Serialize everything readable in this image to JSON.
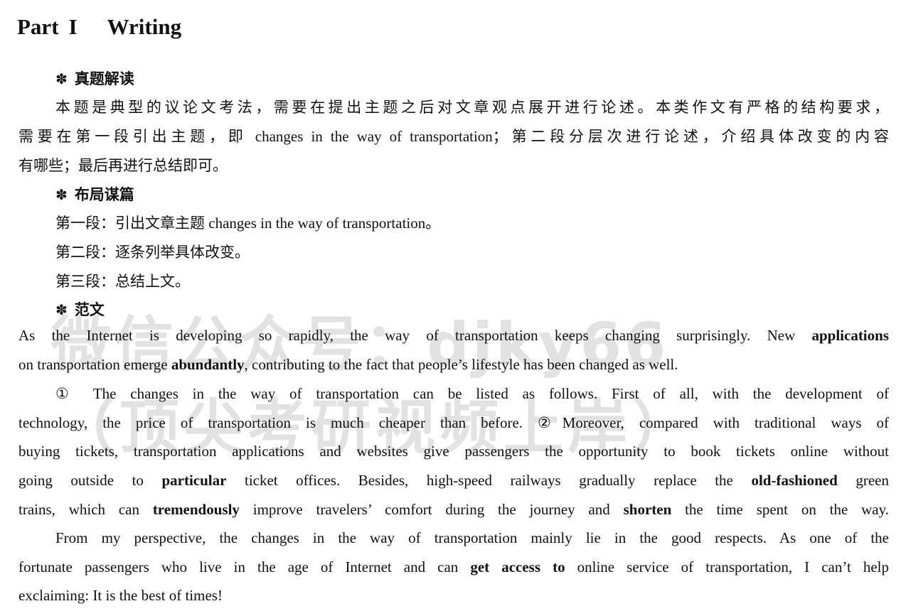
{
  "title": {
    "part": "Part",
    "num": "I",
    "name": "Writing"
  },
  "watermark": {
    "line1": "微信公众号：djky66",
    "line2": "（顶尖考研视频上岸）"
  },
  "sections": [
    {
      "star": "✽",
      "label": "真题解读"
    },
    {
      "star": "✽",
      "label": "布局谋篇"
    },
    {
      "star": "✽",
      "label": "范文"
    }
  ],
  "analysis": {
    "line1": "本题是典型的议论文考法，需要在提出主题之后对文章观点展开进行论述。本类作文有严格的结构要求，",
    "line2": "需要在第一段引出主题，即 changes in the way of transportation；第二段分层次进行论述，介绍具体改变的内容",
    "line3": "有哪些；最后再进行总结即可。"
  },
  "layout_plan": {
    "p1": "第一段：引出文章主题 changes in the way of transportation。",
    "p2": "第二段：逐条列举具体改变。",
    "p3": "第三段：总结上文。"
  },
  "essay": {
    "p1_l1a": "As the Internet is developing so rapidly, the way of transportation keeps changing surprisingly. New ",
    "p1_l1b": "applications",
    "p1_l2a": "on transportation emerge ",
    "p1_l2b": "abundantly",
    "p1_l2c": ", contributing to the fact that people’s lifestyle has been changed as well.",
    "p2_l1": "① The changes in the way of transportation can be listed as follows. First of all, with the development of",
    "p2_l2": "technology, the price of transportation is much cheaper than before. ②Moreover, compared with traditional ways of",
    "p2_l3": "buying tickets, transportation applications and websites give passengers the opportunity to book tickets online without",
    "p2_l4a": "going outside to ",
    "p2_l4b": "particular",
    "p2_l4c": " ticket offices. Besides, high-speed railways gradually replace the ",
    "p2_l4d": "old-fashioned",
    "p2_l4e": " green",
    "p2_l5a": "trains, which can ",
    "p2_l5b": "tremendously",
    "p2_l5c": " improve travelers’ comfort during the journey and ",
    "p2_l5d": "shorten",
    "p2_l5e": " the time spent on the way.",
    "p3_l1": "From my perspective, the changes in the way of transportation mainly lie in the good respects. As one of the",
    "p3_l2a": "fortunate passengers who live in the age of Internet and can ",
    "p3_l2b": "get access to",
    "p3_l2c": " online service of transportation, I can’t help",
    "p3_l3": "exclaiming: It is the best of times!"
  }
}
